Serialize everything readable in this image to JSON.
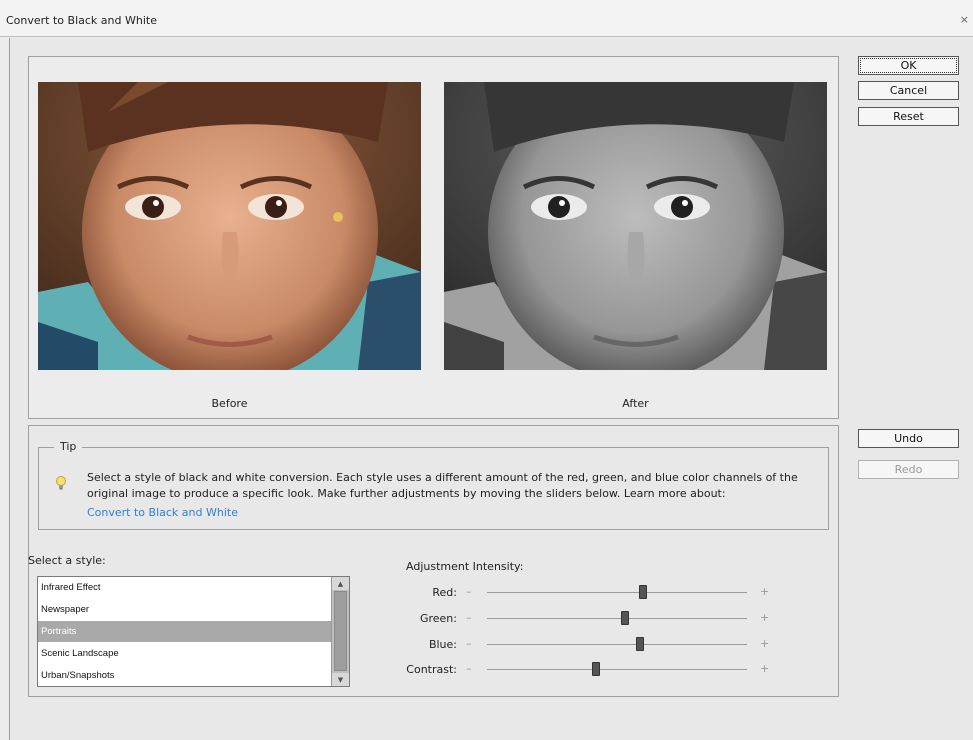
{
  "window": {
    "title": "Convert to Black and White",
    "close_glyph": "×"
  },
  "buttons": {
    "ok": "OK",
    "cancel": "Cancel",
    "reset": "Reset",
    "undo": "Undo",
    "redo": "Redo"
  },
  "preview": {
    "before_label": "Before",
    "after_label": "After"
  },
  "tip": {
    "legend": "Tip",
    "icon": "lightbulb-icon",
    "text": "Select a style of black and white conversion. Each style uses a different amount of the red, green, and blue color channels of the original image to produce a specific look. Make further adjustments by moving the sliders below. Learn more about:",
    "link": "Convert to Black and White"
  },
  "styles": {
    "label": "Select a style:",
    "items": [
      "Infrared Effect",
      "Newspaper",
      "Portraits",
      "Scenic Landscape",
      "Urban/Snapshots"
    ],
    "selected": "Portraits"
  },
  "adjustment": {
    "label": "Adjustment Intensity:",
    "minus": "–",
    "plus": "+",
    "sliders": [
      {
        "name": "Red:",
        "level": 0.6
      },
      {
        "name": "Green:",
        "level": 0.53
      },
      {
        "name": "Blue:",
        "level": 0.59
      },
      {
        "name": "Contrast:",
        "level": 0.42
      }
    ]
  },
  "colors": {
    "accent_link": "#2f7fd8",
    "selection": "#a9a9a9"
  }
}
